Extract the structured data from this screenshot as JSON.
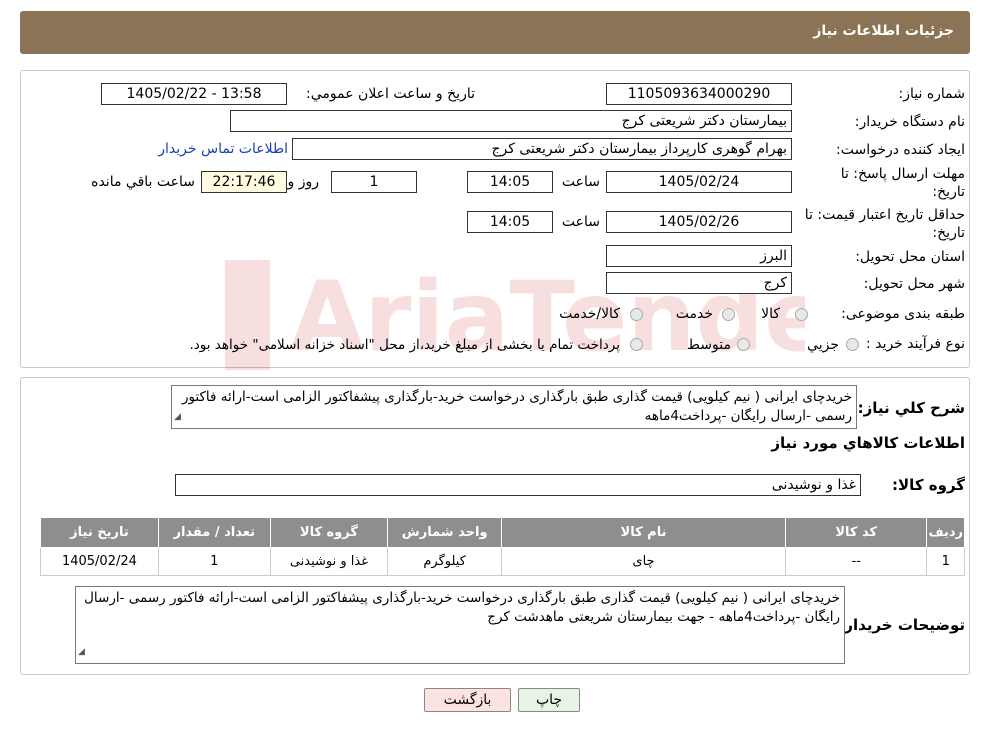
{
  "header": {
    "title": "جزئیات اطلاعات نیاز"
  },
  "labels": {
    "need_number": "شماره نیاز:",
    "announce_datetime": "تاریخ و ساعت اعلان عمومي:",
    "buyer_org": "نام دستگاه خریدار:",
    "requester": "ایجاد کننده درخواست:",
    "contact_link": "اطلاعات تماس خریدار",
    "reply_deadline_line1": "مهلت ارسال پاسخ: تا",
    "reply_deadline_line2": "تاریخ:",
    "time": "ساعت",
    "days_and": "روز و",
    "remaining": "ساعت باقي مانده",
    "price_validity_line1": "حداقل تاریخ اعتبار قیمت: تا",
    "price_validity_line2": "تاریخ:",
    "province": "استان محل تحویل:",
    "city": "شهر محل تحویل:",
    "category": "طبقه بندی موضوعی:",
    "purchase_type": "نوع فرآیند خرید :",
    "general_desc": "شرح كلي نياز:",
    "goods_info": "اطلاعات كالاهاي مورد نياز",
    "goods_group": "گروه كالا:",
    "buyer_notes": "توضیحات خریدار:"
  },
  "fields": {
    "need_number": "1105093634000290",
    "announce_datetime": "1405/02/22 - 13:58",
    "buyer_org": "بیمارستان دکتر شریعتی کرج",
    "requester": "بهرام گوهری کارپرداز بیمارستان دکتر شریعتی کرج",
    "reply_date": "1405/02/24",
    "reply_time": "14:05",
    "reply_days": "1",
    "reply_remaining": "22:17:46",
    "price_date": "1405/02/26",
    "price_time": "14:05",
    "province": "البرز",
    "city": "کرج"
  },
  "category_options": [
    "کالا",
    "خدمت",
    "کالا/خدمت"
  ],
  "purchase_options": [
    "جزیي",
    "متوسط"
  ],
  "purchase_note": "پرداخت تمام یا بخشی از مبلغ خرید،از محل \"اسناد خزانه اسلامی\" خواهد بود.",
  "general_description": "خریدچای ایرانی ( نیم کیلویی)   قیمت گذاری طبق بارگذاری درخواست خرید-بارگذاری پیشفاکتور الزامی است-ارائه فاکتور رسمی -ارسال رایگان -پرداخت4ماهه",
  "goods_group": "غذا و نوشیدنی",
  "table": {
    "headers": [
      "ردیف",
      "کد کالا",
      "نام کالا",
      "واحد شمارش",
      "گروه کالا",
      "تعداد / مقدار",
      "تاریخ نیاز"
    ],
    "rows": [
      [
        "1",
        "--",
        "چای",
        "کیلوگرم",
        "غذا و نوشیدنی",
        "1",
        "1405/02/24"
      ]
    ]
  },
  "buyer_notes": "خریدچای ایرانی ( نیم کیلویی)   قیمت گذاری طبق بارگذاری درخواست خرید-بارگذاری پیشفاکتور الزامی است-ارائه فاکتور رسمی -ارسال رایگان -پرداخت4ماهه - جهت بیمارستان شریعتی ماهدشت کرج",
  "buttons": {
    "print": "چاپ",
    "back": "بازگشت"
  },
  "watermark": {
    "text": "AriaTender.neT"
  },
  "colors": {
    "header_bg": "#8b7355",
    "table_header_bg": "#8e8e8e",
    "link": "#1a3fb0"
  }
}
